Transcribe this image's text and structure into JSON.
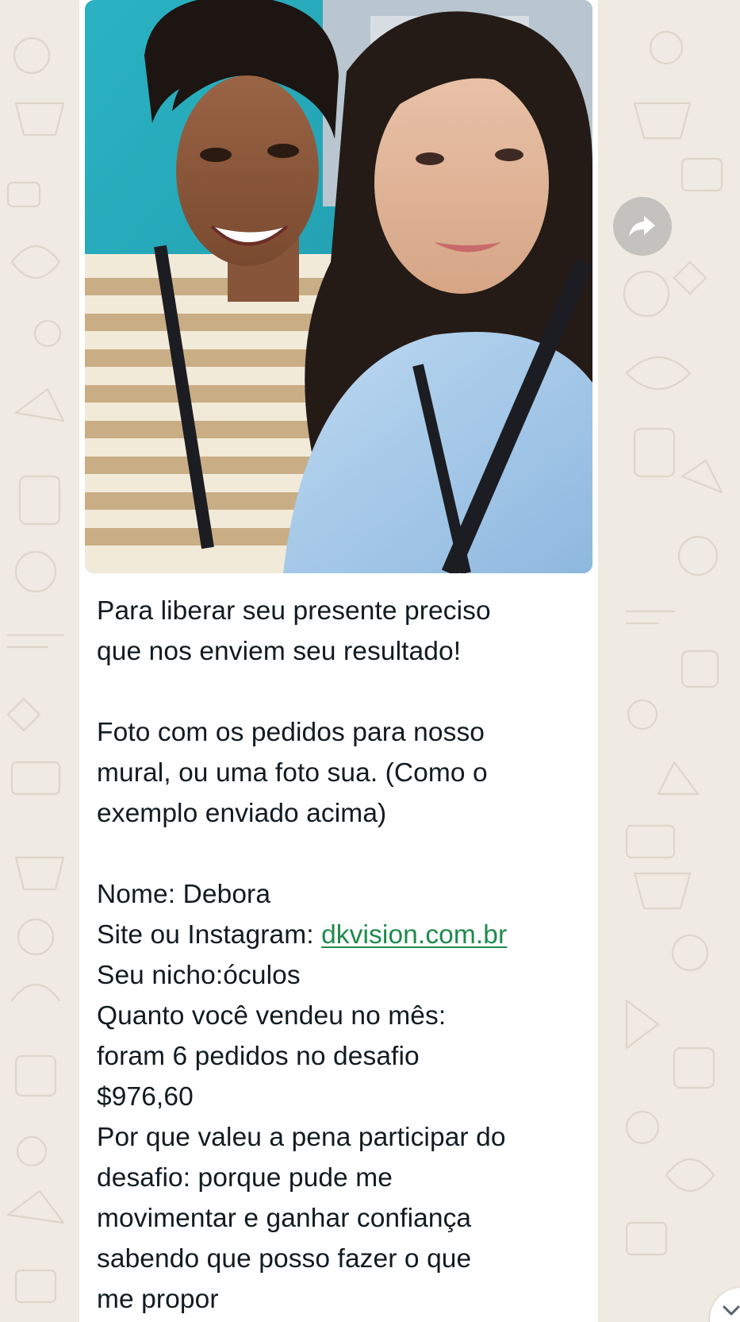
{
  "colors": {
    "chat_background": "#efeae2",
    "bubble_background": "#ffffff",
    "text": "#111b21",
    "link": "#1f8a4c"
  },
  "message": {
    "image": {
      "icon": "photo-of-two-women-selfie"
    },
    "caption_lines": [
      "Para liberar seu presente preciso",
      "que nos enviem seu resultado!",
      "",
      "Foto com os pedidos para nosso",
      "mural, ou uma foto sua. (Como o",
      "exemplo enviado acima)",
      "",
      "Nome: Debora"
    ],
    "site_label": "Site ou Instagram: ",
    "site_link": "dkvision.com.br",
    "caption_lines_after": [
      "Seu nicho:óculos",
      "Quanto você vendeu no mês:",
      "foram 6 pedidos no desafio",
      "$976,60",
      "Por que valeu a pena participar do",
      "desafio: porque pude me",
      "movimentar e ganhar confiança",
      "sabendo que posso fazer o que",
      "me propor"
    ]
  },
  "buttons": {
    "forward_icon": "forward-arrow-icon",
    "scroll_down_icon": "chevron-down-icon"
  }
}
